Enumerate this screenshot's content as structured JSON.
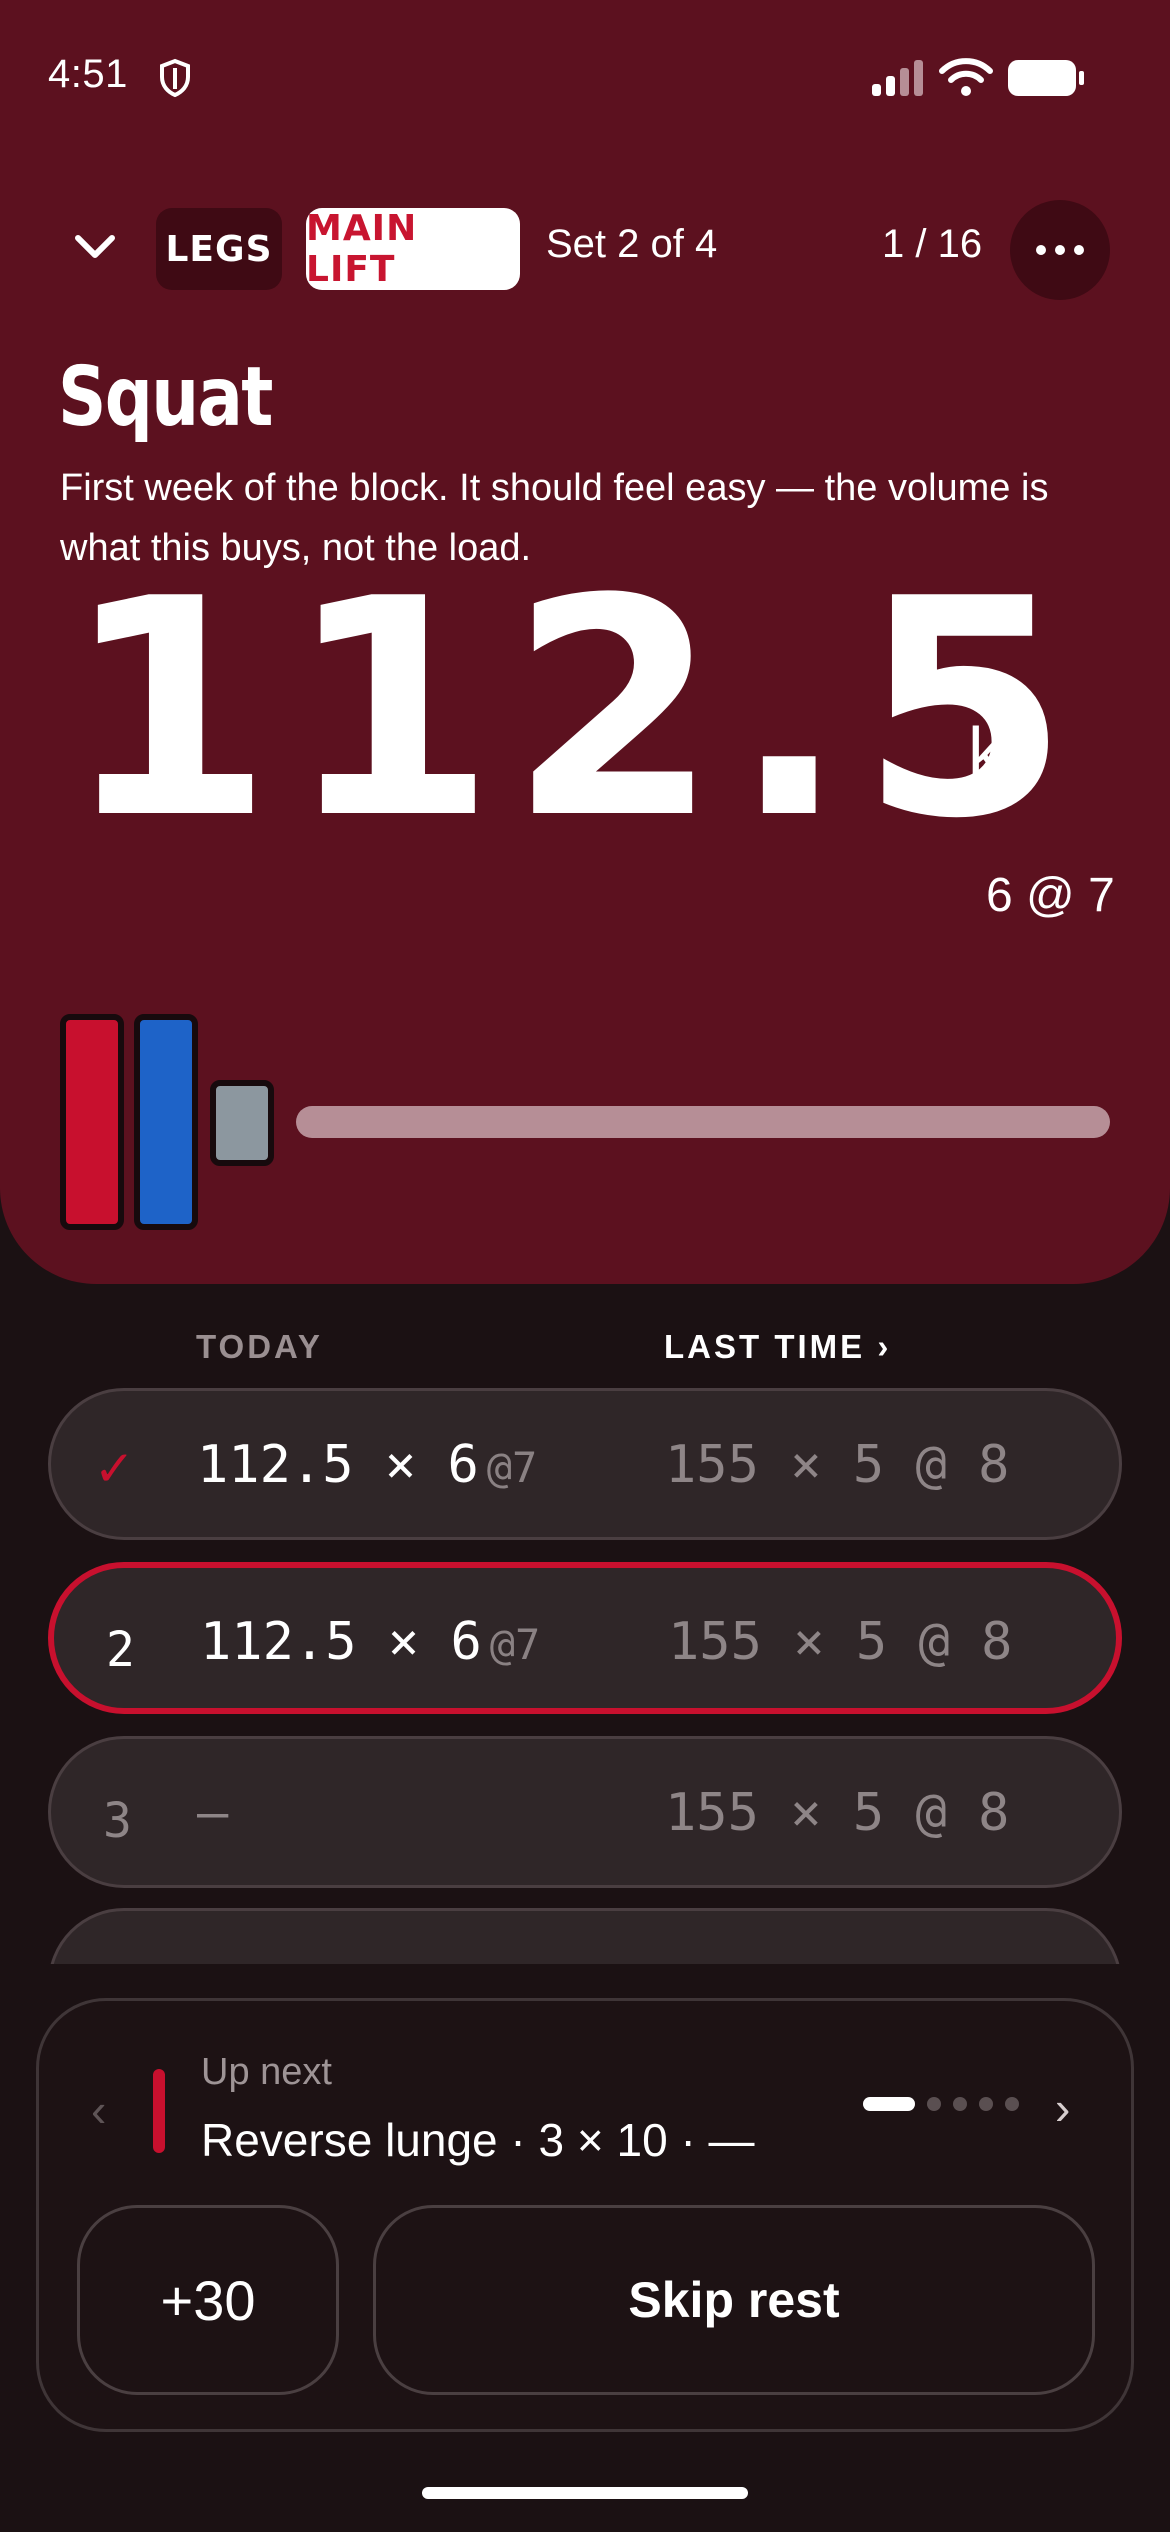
{
  "status_bar": {
    "time": "4:51"
  },
  "header": {
    "tag_group": "LEGS",
    "tag_type": "MAIN LIFT",
    "set_label": "Set 2 of 4",
    "counter": "1 / 16"
  },
  "exercise": {
    "title": "Squat",
    "description": "First week of the block. It should feel easy — the volume is what this buys, not the load.",
    "weight": "112.5",
    "unit": "kg",
    "target": "6 @ 7"
  },
  "plates": [
    {
      "color": "#c8102e"
    },
    {
      "color": "#1e63c8"
    },
    {
      "color": "#8c979f"
    }
  ],
  "table": {
    "col_today": "TODAY",
    "col_last": "LAST TIME ›",
    "rows": [
      {
        "index": "✓",
        "today": "112.5 × 6",
        "rpe": "@7",
        "last": "155 × 5 @ 8"
      },
      {
        "index": "2",
        "today": "112.5 × 6",
        "rpe": "@7",
        "last": "155 × 5 @ 8"
      },
      {
        "index": "3",
        "today": "—",
        "rpe": "",
        "last": "155 × 5 @ 8"
      }
    ]
  },
  "up_next": {
    "label": "Up next",
    "text": "Reverse lunge · 3 × 10 · —",
    "prev_icon": "‹",
    "next_icon": "›",
    "page_dots": 5,
    "active_dot": 1
  },
  "actions": {
    "add_time": "+30",
    "skip_rest": "Skip rest"
  },
  "colors": {
    "hero_bg": "#5c111f",
    "accent": "#c8102e",
    "app_bg": "#1b1113"
  }
}
